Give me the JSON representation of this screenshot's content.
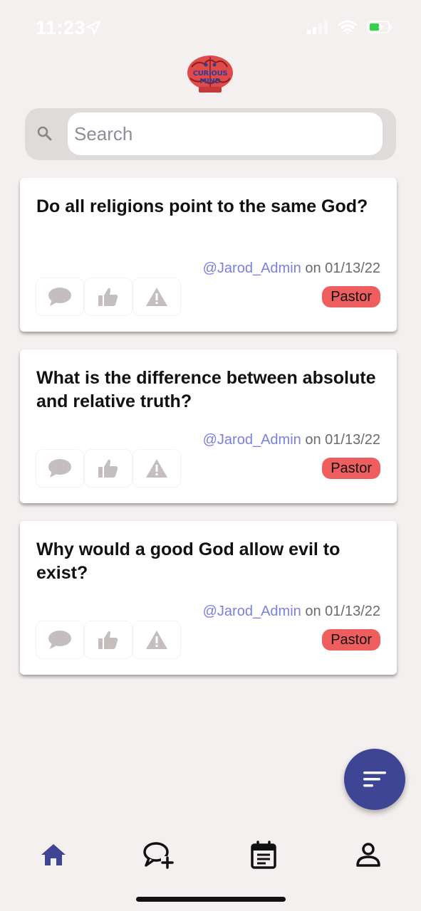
{
  "status_bar": {
    "time": "11:23"
  },
  "logo": {
    "text": "CURIOUS MIND"
  },
  "search": {
    "placeholder": "Search",
    "value": ""
  },
  "posts": [
    {
      "title": "Do all religions point to the same God?",
      "author": "@Jarod_Admin",
      "on_label": "on",
      "date": "01/13/22",
      "badge": "Pastor"
    },
    {
      "title": "What is the difference between absolute and relative truth?",
      "author": "@Jarod_Admin",
      "on_label": "on",
      "date": "01/13/22",
      "badge": "Pastor"
    },
    {
      "title": "Why would a good God allow evil to exist?",
      "author": "@Jarod_Admin",
      "on_label": "on",
      "date": "01/13/22",
      "badge": "Pastor"
    }
  ],
  "icons": {
    "comment": "comment-icon",
    "like": "thumbs-up-icon",
    "report": "warning-icon",
    "filter": "filter-icon",
    "home": "home-icon",
    "new_question": "chat-plus-icon",
    "calendar": "calendar-icon",
    "profile": "person-icon"
  },
  "colors": {
    "background": "#f5f0f0",
    "accent": "#3d4594",
    "badge": "#ee5e5e",
    "author": "#7b7fe0",
    "icon_muted": "#c4bebe"
  }
}
